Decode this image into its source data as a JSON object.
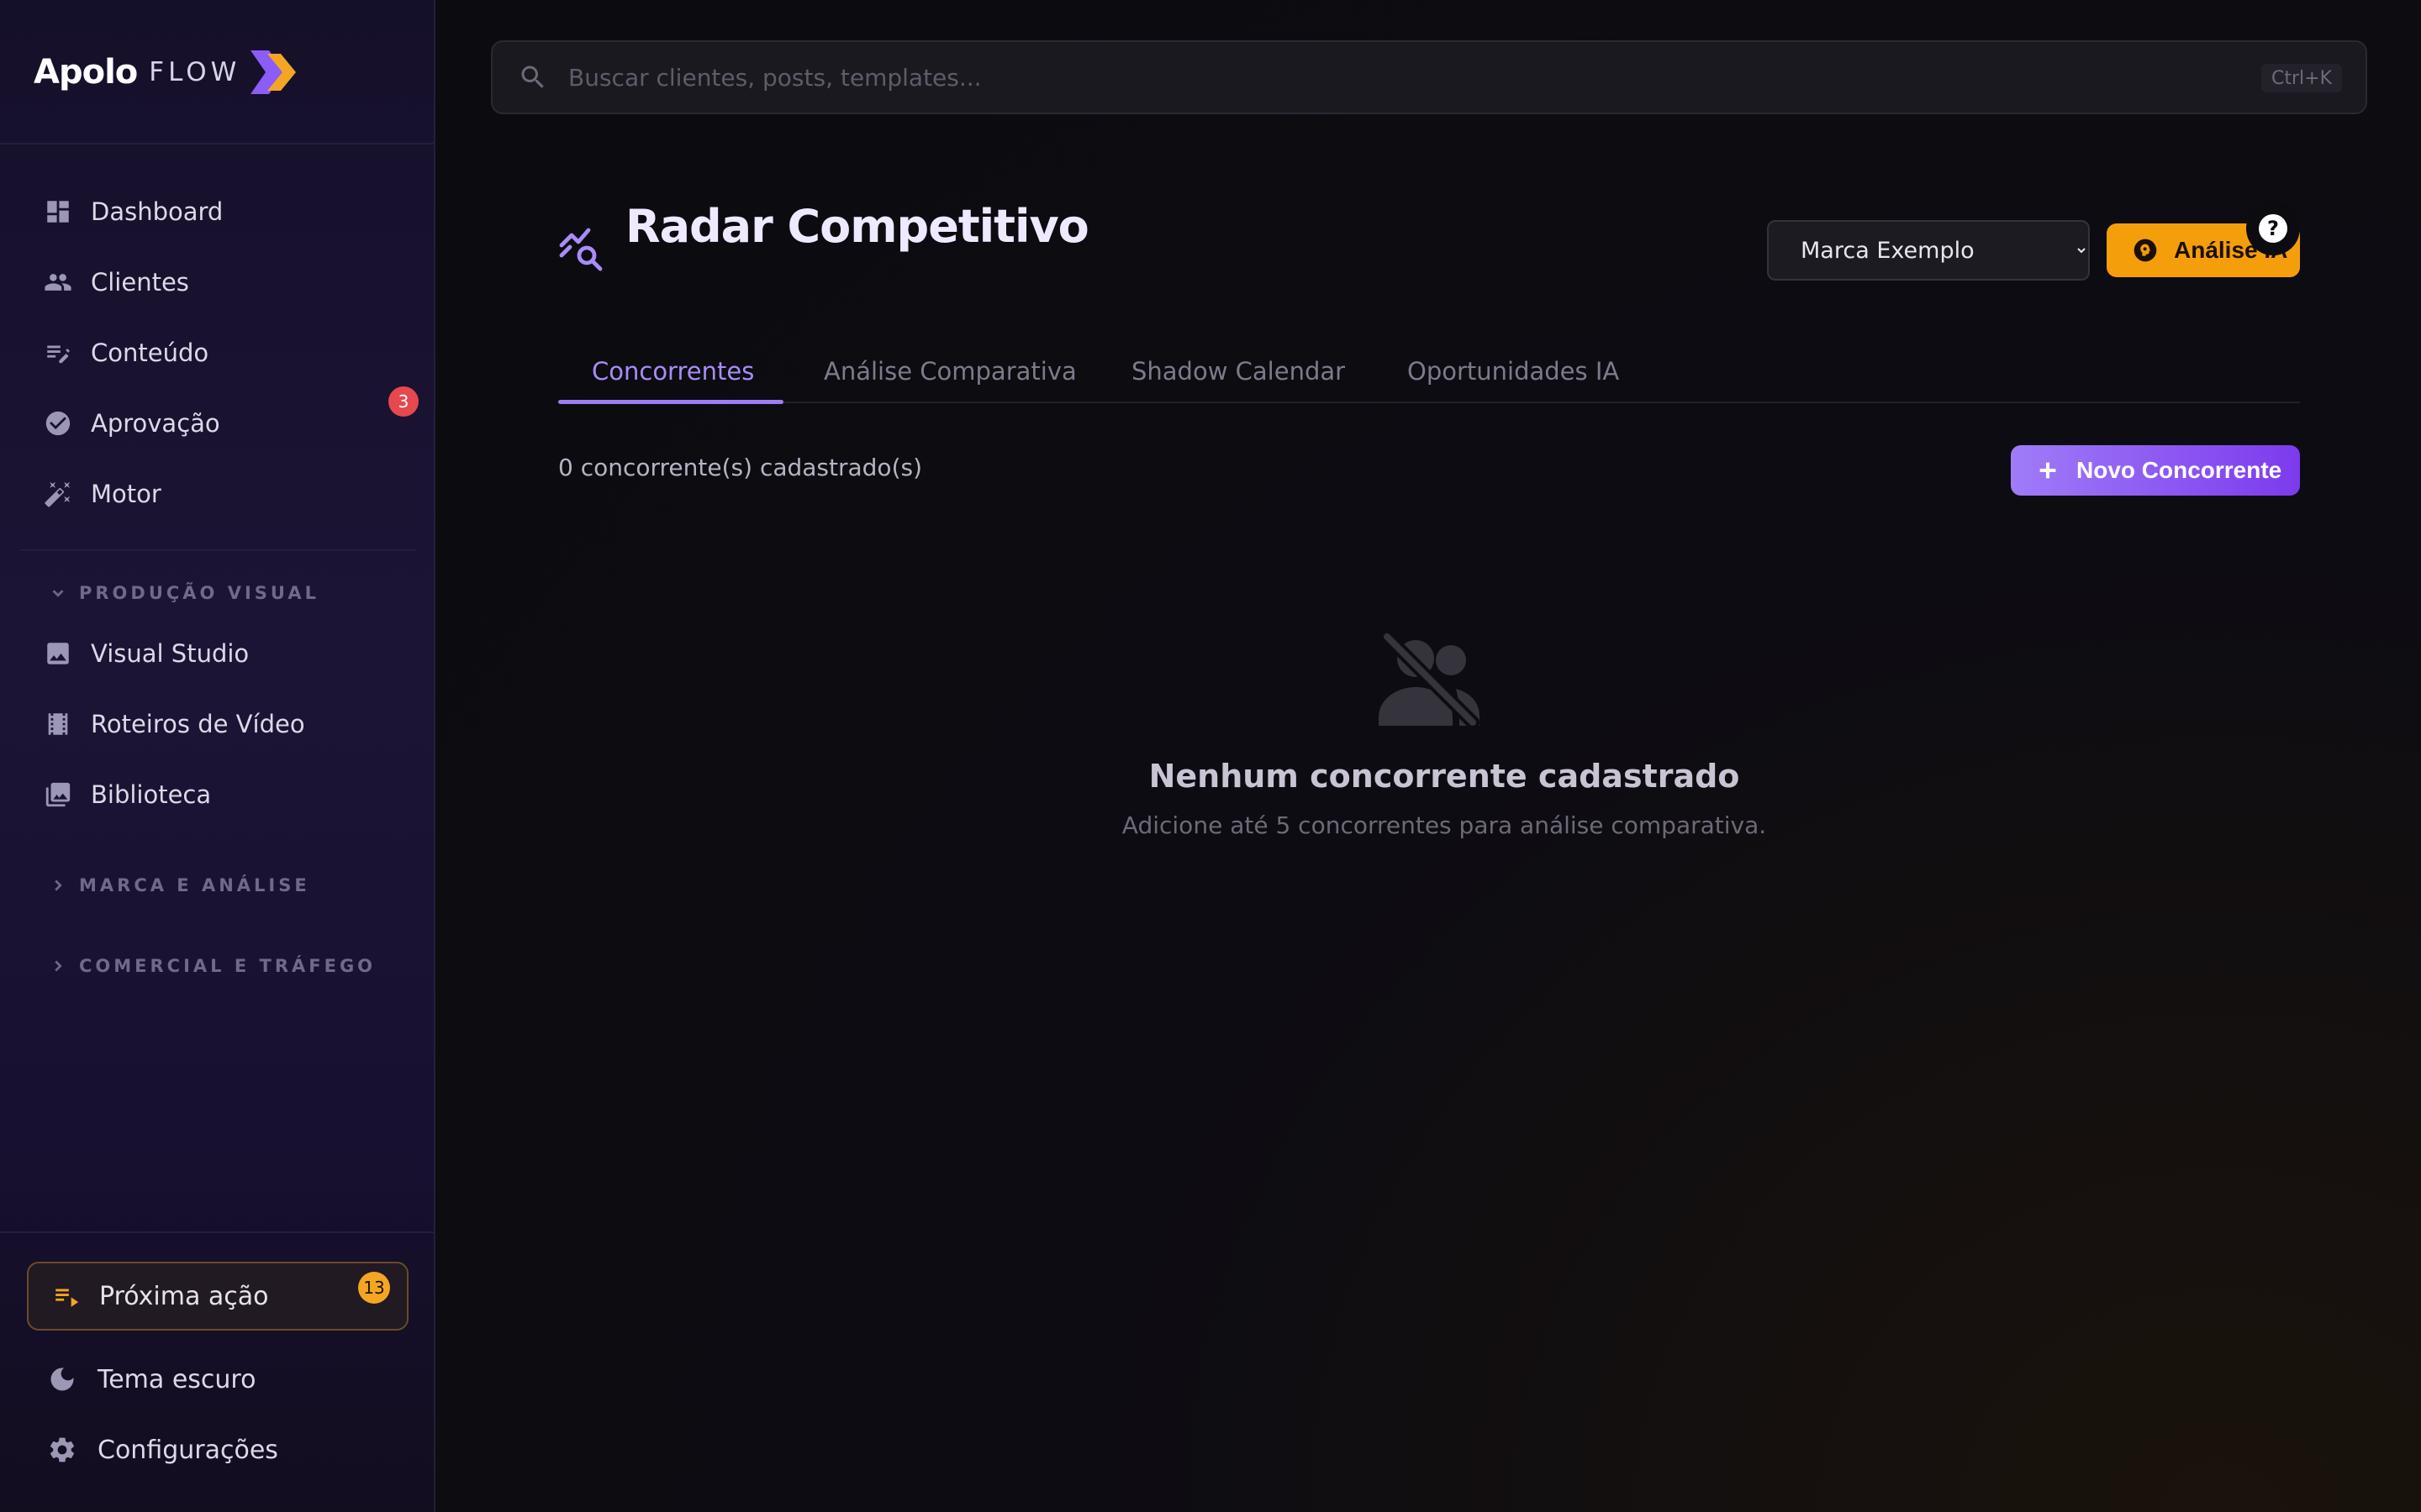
{
  "brand": {
    "name": "Apolo",
    "product": "FLOW"
  },
  "sidebar": {
    "items": [
      {
        "label": "Dashboard",
        "icon": "dashboard-icon"
      },
      {
        "label": "Clientes",
        "icon": "users-icon"
      },
      {
        "label": "Conteúdo",
        "icon": "edit-list-icon"
      },
      {
        "label": "Aprovação",
        "icon": "check-circle-icon",
        "badge": "3"
      },
      {
        "label": "Motor",
        "icon": "magic-wand-icon"
      }
    ],
    "sections": [
      {
        "label": "PRODUÇÃO VISUAL",
        "expanded": true,
        "items": [
          {
            "label": "Visual Studio",
            "icon": "image-icon"
          },
          {
            "label": "Roteiros de Vídeo",
            "icon": "film-icon"
          },
          {
            "label": "Biblioteca",
            "icon": "photo-library-icon"
          }
        ]
      },
      {
        "label": "MARCA E ANÁLISE",
        "expanded": false
      },
      {
        "label": "COMERCIAL E TRÁFEGO",
        "expanded": false
      }
    ],
    "footer": {
      "next_action": {
        "label": "Próxima ação",
        "badge": "13",
        "icon": "playlist-play-icon"
      },
      "theme": {
        "label": "Tema escuro",
        "icon": "moon-icon"
      },
      "settings": {
        "label": "Configurações",
        "icon": "gear-icon"
      }
    }
  },
  "search": {
    "placeholder": "Buscar clientes, posts, templates...",
    "shortcut": "Ctrl+K",
    "value": ""
  },
  "page": {
    "title": "Radar Competitivo",
    "icon": "radar-search-icon",
    "brand_select": {
      "selected": "Marca Exemplo"
    },
    "ai_button": {
      "label": "Análise IA"
    },
    "help": "?"
  },
  "tabs": [
    {
      "label": "Concorrentes",
      "active": true
    },
    {
      "label": "Análise Comparativa",
      "active": false
    },
    {
      "label": "Shadow Calendar",
      "active": false
    },
    {
      "label": "Oportunidades IA",
      "active": false
    }
  ],
  "competitors": {
    "count_text": "0 concorrente(s) cadastrado(s)",
    "new_button": "Novo Concorrente",
    "empty_title": "Nenhum concorrente cadastrado",
    "empty_subtitle": "Adicione até 5 concorrentes para análise comparativa."
  },
  "colors": {
    "accent_purple": "#9c7ef2",
    "accent_amber": "#f59e0b",
    "badge_red": "#e5484d"
  }
}
